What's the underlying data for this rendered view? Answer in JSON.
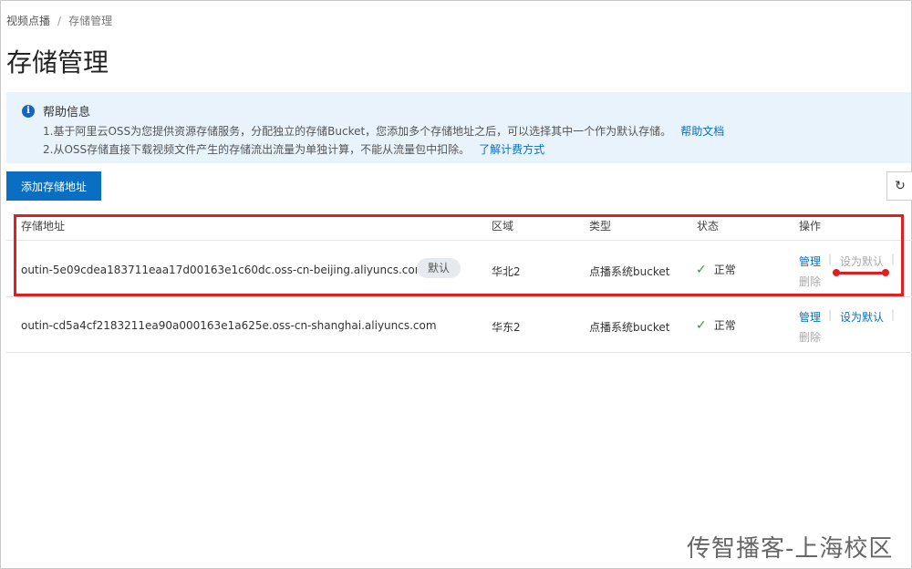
{
  "breadcrumb": {
    "parent": "视频点播",
    "separator": "/",
    "current": "存储管理"
  },
  "page_title": "存储管理",
  "help": {
    "icon": "info-icon",
    "title": "帮助信息",
    "line1": "1.基于阿里云OSS为您提供资源存储服务，分配独立的存储Bucket，您添加多个存储地址之后，可以选择其中一个作为默认存储。",
    "line1_link": "帮助文档",
    "line2": "2.从OSS存储直接下载视频文件产生的存储流出流量为单独计算，不能从流量包中扣除。",
    "line2_link": "了解计费方式"
  },
  "toolbar": {
    "add_label": "添加存储地址",
    "refresh_icon": "↻"
  },
  "table": {
    "headers": {
      "address": "存储地址",
      "region": "区域",
      "type": "类型",
      "status": "状态",
      "actions": "操作"
    },
    "rows": [
      {
        "address": "outin-5e09cdea183711eaa17d00163e1c60dc.oss-cn-beijing.aliyuncs.com",
        "badge": "默认",
        "region": "华北2",
        "type": "点播系统bucket",
        "status": "正常",
        "manage": "管理",
        "set_default": "设为默认",
        "delete": "删除"
      },
      {
        "address": "outin-cd5a4cf2183211ea90a000163e1a625e.oss-cn-shanghai.aliyuncs.com",
        "region": "华东2",
        "type": "点播系统bucket",
        "status": "正常",
        "manage": "管理",
        "set_default": "设为默认",
        "delete": "删除"
      }
    ],
    "separator": "|",
    "status_icon": "✓"
  },
  "watermark": "传智播客-上海校区",
  "colors": {
    "primary": "#0a6fc2",
    "help_bg": "#e8f3fc",
    "success": "#2a9d3a",
    "annotation": "#e02020"
  }
}
